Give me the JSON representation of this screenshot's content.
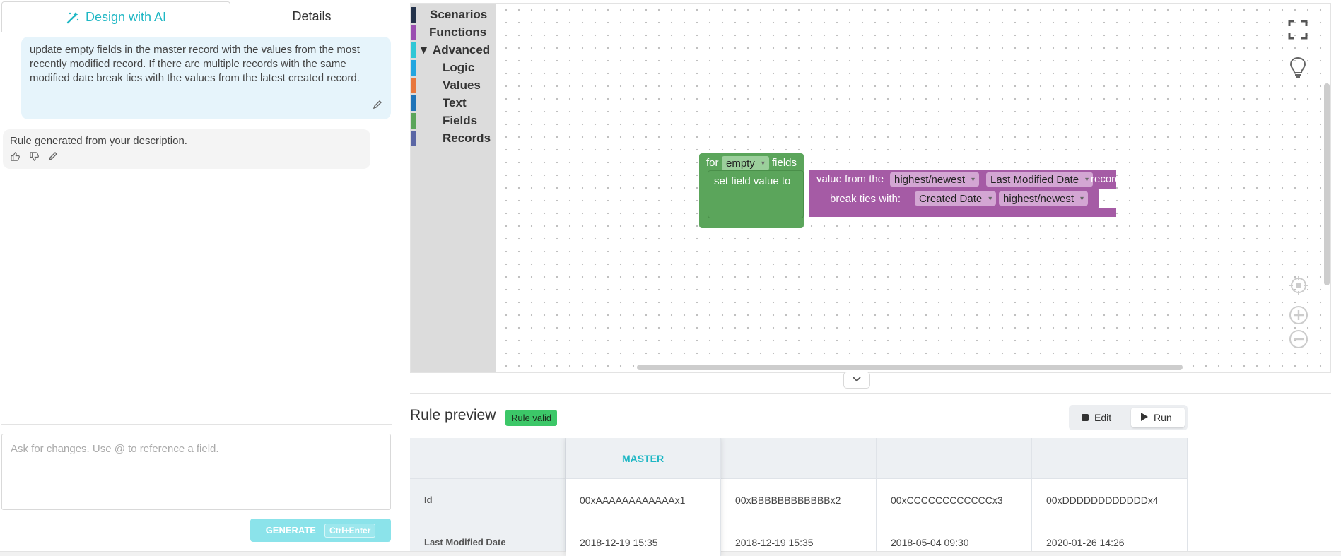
{
  "tabs": {
    "design_ai": "Design with AI",
    "details": "Details"
  },
  "chat": {
    "user_message": "update empty fields in the master record with the values from the most recently modified record. If there are multiple records with the same modified date break ties with the values from the latest created record.",
    "ai_message": "Rule generated from your description."
  },
  "prompt": {
    "placeholder": "Ask for changes. Use @ to reference a field."
  },
  "generate": {
    "label": "GENERATE",
    "shortcut": "Ctrl+Enter"
  },
  "toolbox": {
    "items": [
      {
        "label": "Scenarios",
        "color": "#23324a"
      },
      {
        "label": "Functions",
        "color": "#9a4fb0"
      },
      {
        "label": "▼ Advanced",
        "color": "#2fc7d6"
      },
      {
        "label": "Logic",
        "color": "#23a6e0"
      },
      {
        "label": "Values",
        "color": "#e8773d"
      },
      {
        "label": "Text",
        "color": "#1f74b8"
      },
      {
        "label": "Fields",
        "color": "#5ba55b"
      },
      {
        "label": "Records",
        "color": "#5b67a5"
      }
    ]
  },
  "blocks": {
    "for": "for",
    "empty": "empty",
    "fields": "fields",
    "set_field_value": "set field value to",
    "value_from_the": "value from the",
    "highest_newest_1": "highest/newest",
    "last_modified_date": "Last Modified Date",
    "record": "record",
    "break_ties": "break ties with:",
    "created_date": "Created Date",
    "highest_newest_2": "highest/newest"
  },
  "preview": {
    "title": "Rule preview",
    "badge": "Rule valid",
    "edit_label": "Edit",
    "run_label": "Run",
    "master_header": "MASTER",
    "rows": [
      {
        "label": "Id",
        "values": [
          "00xAAAAAAAAAAAAx1",
          "00xBBBBBBBBBBBBx2",
          "00xCCCCCCCCCCCCx3",
          "00xDDDDDDDDDDDDx4"
        ]
      },
      {
        "label": "Last Modified Date",
        "values": [
          "2018-12-19 15:35",
          "2018-12-19 15:35",
          "2018-05-04 09:30",
          "2020-01-26 14:26"
        ]
      }
    ]
  },
  "colors": {
    "accent": "#1fb7c4",
    "block_green": "#5ba55b",
    "block_purple": "#a55ba5",
    "valid": "#3cc768"
  }
}
